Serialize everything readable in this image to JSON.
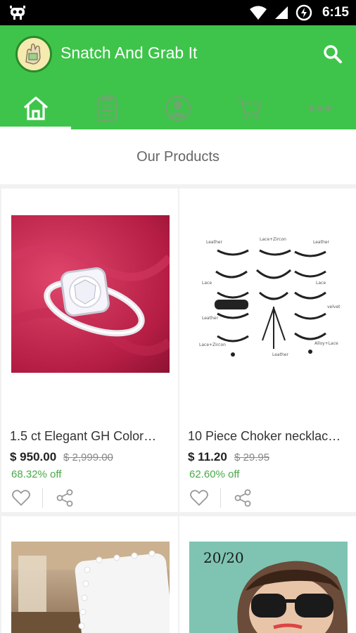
{
  "status_bar": {
    "time": "6:15"
  },
  "app": {
    "title": "Snatch And Grab It"
  },
  "tabs": [
    {
      "name": "home",
      "icon": "home-icon",
      "active": true
    },
    {
      "name": "orders",
      "icon": "clipboard-icon",
      "active": false
    },
    {
      "name": "account",
      "icon": "user-icon",
      "active": false
    },
    {
      "name": "cart",
      "icon": "cart-icon",
      "active": false
    },
    {
      "name": "more",
      "icon": "more-icon",
      "active": false
    }
  ],
  "section": {
    "title": "Our Products"
  },
  "products": [
    {
      "name": "1.5 ct Elegant GH Color…",
      "price": "$ 950.00",
      "old_price": "$ 2,999.00",
      "discount": "68.32% off",
      "image": "ring-image"
    },
    {
      "name": "10 Piece Choker necklac…",
      "price": "$ 11.20",
      "old_price": "$ 29.95",
      "discount": "62.60% off",
      "image": "chokers-image"
    },
    {
      "name": "",
      "image": "mirror-image"
    },
    {
      "name": "",
      "image": "sunglasses-image"
    }
  ],
  "chokers_labels": [
    "Leather",
    "Lace+Zircon",
    "Leather",
    "Lace",
    "Leather",
    "Lace",
    "Leather",
    "Alloy+Lace",
    "Leather",
    "Lace+Zircon",
    "velvet"
  ],
  "colors": {
    "brand": "#3ec44a",
    "discount": "#4aa84a"
  }
}
